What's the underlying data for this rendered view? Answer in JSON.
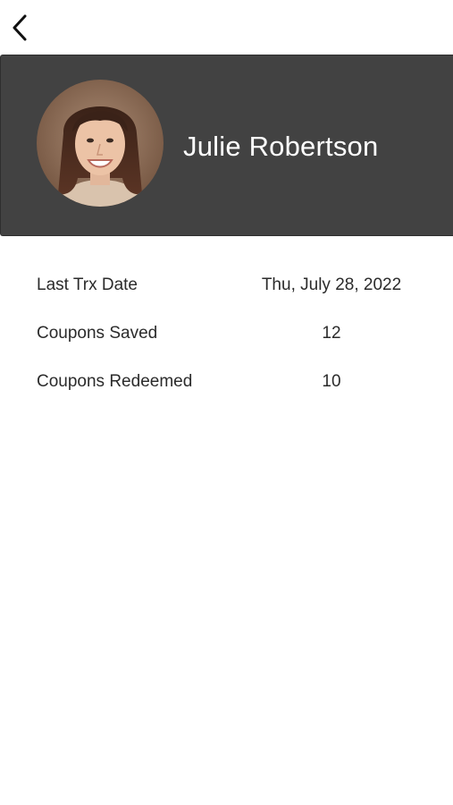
{
  "navigation": {
    "back_icon": "chevron-left-icon"
  },
  "profile": {
    "name": "Julie Robertson",
    "avatar_icon": "user-photo",
    "header_color": "#424242"
  },
  "stats": [
    {
      "label": "Last Trx Date",
      "value": "Thu, July 28, 2022"
    },
    {
      "label": "Coupons Saved",
      "value": "12"
    },
    {
      "label": "Coupons Redeemed",
      "value": "10"
    }
  ]
}
